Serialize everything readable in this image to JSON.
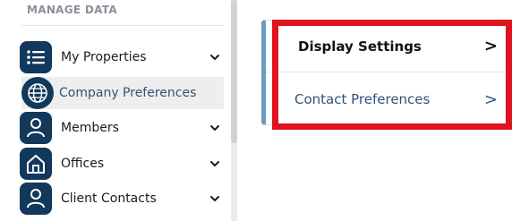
{
  "sidebar": {
    "section_title": "MANAGE DATA",
    "items": [
      {
        "label": "My Properties",
        "icon": "list-icon",
        "has_chevron": true
      },
      {
        "label": "Company Preferences",
        "icon": "globe-icon",
        "has_chevron": false,
        "active": true
      },
      {
        "label": "Members",
        "icon": "person-icon",
        "has_chevron": true
      },
      {
        "label": "Offices",
        "icon": "house-icon",
        "has_chevron": true
      },
      {
        "label": "Client Contacts",
        "icon": "person-icon",
        "has_chevron": true
      }
    ]
  },
  "settings_card": {
    "rows": [
      {
        "label": "Display Settings",
        "arrow": ">"
      },
      {
        "label": "Contact Preferences",
        "arrow": ">"
      }
    ]
  },
  "colors": {
    "icon_bg": "#12385c",
    "accent_bar": "#6a9cc0",
    "highlight": "#e0141e",
    "link_text": "#2f5478"
  }
}
